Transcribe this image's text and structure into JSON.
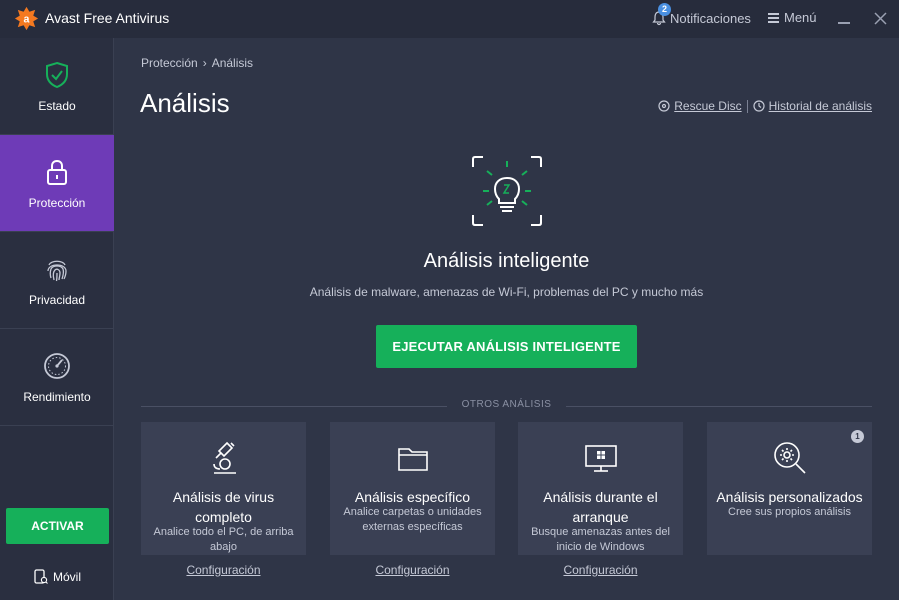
{
  "app": {
    "title": "Avast Free Antivirus"
  },
  "header": {
    "notifications_label": "Notificaciones",
    "notifications_count": "2",
    "menu_label": "Menú"
  },
  "sidebar": {
    "items": [
      {
        "label": "Estado",
        "icon": "shield-check-icon"
      },
      {
        "label": "Protección",
        "icon": "lock-icon",
        "active": true
      },
      {
        "label": "Privacidad",
        "icon": "fingerprint-icon"
      },
      {
        "label": "Rendimiento",
        "icon": "speedometer-icon"
      }
    ],
    "activate_label": "ACTIVAR",
    "mobile_label": "Móvil"
  },
  "main": {
    "breadcrumb": {
      "parent": "Protección",
      "separator": "›",
      "current": "Análisis"
    },
    "title": "Análisis",
    "links": {
      "rescue_disc": "Rescue Disc",
      "history": "Historial de análisis"
    },
    "smart_scan": {
      "title": "Análisis inteligente",
      "subtitle": "Análisis de malware, amenazas de Wi-Fi, problemas del PC y mucho más",
      "button": "EJECUTAR ANÁLISIS INTELIGENTE"
    },
    "others_heading": "OTROS ANÁLISIS",
    "cards": [
      {
        "title": "Análisis de virus completo",
        "description": "Analice todo el PC, de arriba abajo",
        "config": "Configuración",
        "icon": "microscope-icon"
      },
      {
        "title": "Análisis específico",
        "description": "Analice carpetas o unidades externas específicas",
        "config": "Configuración",
        "icon": "folder-icon"
      },
      {
        "title": "Análisis durante el arranque",
        "description": "Busque amenazas antes del inicio de Windows",
        "config": "Configuración",
        "icon": "monitor-windows-icon"
      },
      {
        "title": "Análisis personalizados",
        "description": "Cree sus propios análisis",
        "badge": "1",
        "icon": "magnifier-gear-icon"
      }
    ]
  },
  "colors": {
    "background": "#2f3547",
    "sidebar": "#2a2f40",
    "active_nav": "#6e3bb7",
    "accent_green": "#16b05a",
    "card": "#3a4054",
    "brand_orange": "#f47920"
  }
}
